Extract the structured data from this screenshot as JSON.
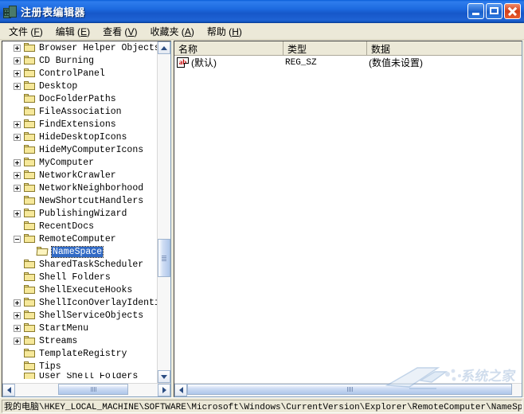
{
  "window": {
    "title": "注册表编辑器",
    "icon": "registry-editor-icon",
    "buttons": {
      "minimize": "–",
      "maximize": "□",
      "close": "✕"
    }
  },
  "menu": [
    {
      "label": "文件",
      "accel": "F"
    },
    {
      "label": "编辑",
      "accel": "E"
    },
    {
      "label": "查看",
      "accel": "V"
    },
    {
      "label": "收藏夹",
      "accel": "A"
    },
    {
      "label": "帮助",
      "accel": "H"
    }
  ],
  "tree": {
    "items": [
      {
        "label": "Browser Helper Objects",
        "expander": "plus",
        "indent": 1,
        "selected": false
      },
      {
        "label": "CD Burning",
        "expander": "plus",
        "indent": 1,
        "selected": false
      },
      {
        "label": "ControlPanel",
        "expander": "plus",
        "indent": 1,
        "selected": false
      },
      {
        "label": "Desktop",
        "expander": "plus",
        "indent": 1,
        "selected": false
      },
      {
        "label": "DocFolderPaths",
        "expander": "none",
        "indent": 1,
        "selected": false
      },
      {
        "label": "FileAssociation",
        "expander": "none",
        "indent": 1,
        "selected": false
      },
      {
        "label": "FindExtensions",
        "expander": "plus",
        "indent": 1,
        "selected": false
      },
      {
        "label": "HideDesktopIcons",
        "expander": "plus",
        "indent": 1,
        "selected": false
      },
      {
        "label": "HideMyComputerIcons",
        "expander": "none",
        "indent": 1,
        "selected": false
      },
      {
        "label": "MyComputer",
        "expander": "plus",
        "indent": 1,
        "selected": false
      },
      {
        "label": "NetworkCrawler",
        "expander": "plus",
        "indent": 1,
        "selected": false
      },
      {
        "label": "NetworkNeighborhood",
        "expander": "plus",
        "indent": 1,
        "selected": false
      },
      {
        "label": "NewShortcutHandlers",
        "expander": "none",
        "indent": 1,
        "selected": false
      },
      {
        "label": "PublishingWizard",
        "expander": "plus",
        "indent": 1,
        "selected": false
      },
      {
        "label": "RecentDocs",
        "expander": "none",
        "indent": 1,
        "selected": false
      },
      {
        "label": "RemoteComputer",
        "expander": "minus",
        "indent": 1,
        "selected": false
      },
      {
        "label": "NameSpace",
        "expander": "none",
        "indent": 2,
        "selected": true
      },
      {
        "label": "SharedTaskScheduler",
        "expander": "none",
        "indent": 1,
        "selected": false
      },
      {
        "label": "Shell Folders",
        "expander": "none",
        "indent": 1,
        "selected": false
      },
      {
        "label": "ShellExecuteHooks",
        "expander": "none",
        "indent": 1,
        "selected": false
      },
      {
        "label": "ShellIconOverlayIdenti",
        "expander": "plus",
        "indent": 1,
        "selected": false
      },
      {
        "label": "ShellServiceObjects",
        "expander": "plus",
        "indent": 1,
        "selected": false
      },
      {
        "label": "StartMenu",
        "expander": "plus",
        "indent": 1,
        "selected": false
      },
      {
        "label": "Streams",
        "expander": "plus",
        "indent": 1,
        "selected": false
      },
      {
        "label": "TemplateRegistry",
        "expander": "none",
        "indent": 1,
        "selected": false
      },
      {
        "label": "Tips",
        "expander": "none",
        "indent": 1,
        "selected": false
      },
      {
        "label": "User Shell Folders",
        "expander": "none",
        "indent": 1,
        "selected": false
      }
    ]
  },
  "list": {
    "columns": [
      "名称",
      "类型",
      "数据"
    ],
    "rows": [
      {
        "name": "(默认)",
        "type": "REG_SZ",
        "data": "(数值未设置)",
        "icon": "string-value-icon"
      }
    ]
  },
  "status": {
    "path": "我的电脑\\HKEY_LOCAL_MACHINE\\SOFTWARE\\Microsoft\\Windows\\CurrentVersion\\Explorer\\RemoteComputer\\NameSpace"
  },
  "watermark": {
    "text": "系统之家"
  },
  "colors": {
    "title_blue": "#1d6ae0",
    "selection_blue": "#316ac5",
    "face": "#ece9d8",
    "folder_yellow": "#f6e89a"
  }
}
